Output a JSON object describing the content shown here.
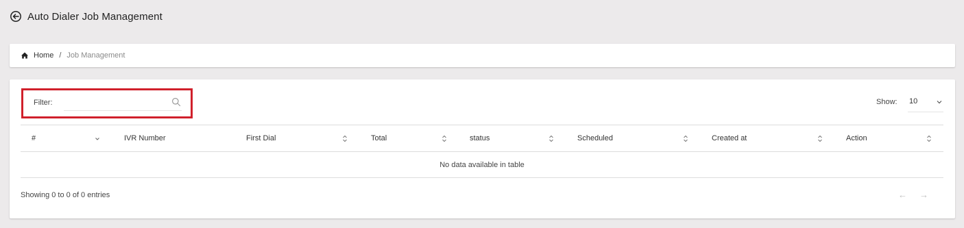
{
  "header": {
    "title": "Auto Dialer Job Management"
  },
  "breadcrumb": {
    "home": "Home",
    "separator": "/",
    "current": "Job Management"
  },
  "filter": {
    "label": "Filter:",
    "value": "",
    "placeholder": ""
  },
  "show": {
    "label": "Show:",
    "value": "10"
  },
  "table": {
    "columns": [
      {
        "label": "#",
        "indicator": "chevron-down-icon"
      },
      {
        "label": "IVR Number",
        "indicator": "none"
      },
      {
        "label": "First Dial",
        "indicator": "sort-icon"
      },
      {
        "label": "Total",
        "indicator": "sort-icon"
      },
      {
        "label": "status",
        "indicator": "sort-icon"
      },
      {
        "label": "Scheduled",
        "indicator": "sort-icon"
      },
      {
        "label": "Created at",
        "indicator": "sort-icon"
      },
      {
        "label": "Action",
        "indicator": "sort-icon"
      }
    ],
    "empty_message": "No data available in table"
  },
  "footer": {
    "info": "Showing 0 to 0 of 0 entries",
    "prev": "←",
    "next": "→"
  },
  "colors": {
    "highlight_border": "#d0202b",
    "background": "#eceaeb"
  }
}
